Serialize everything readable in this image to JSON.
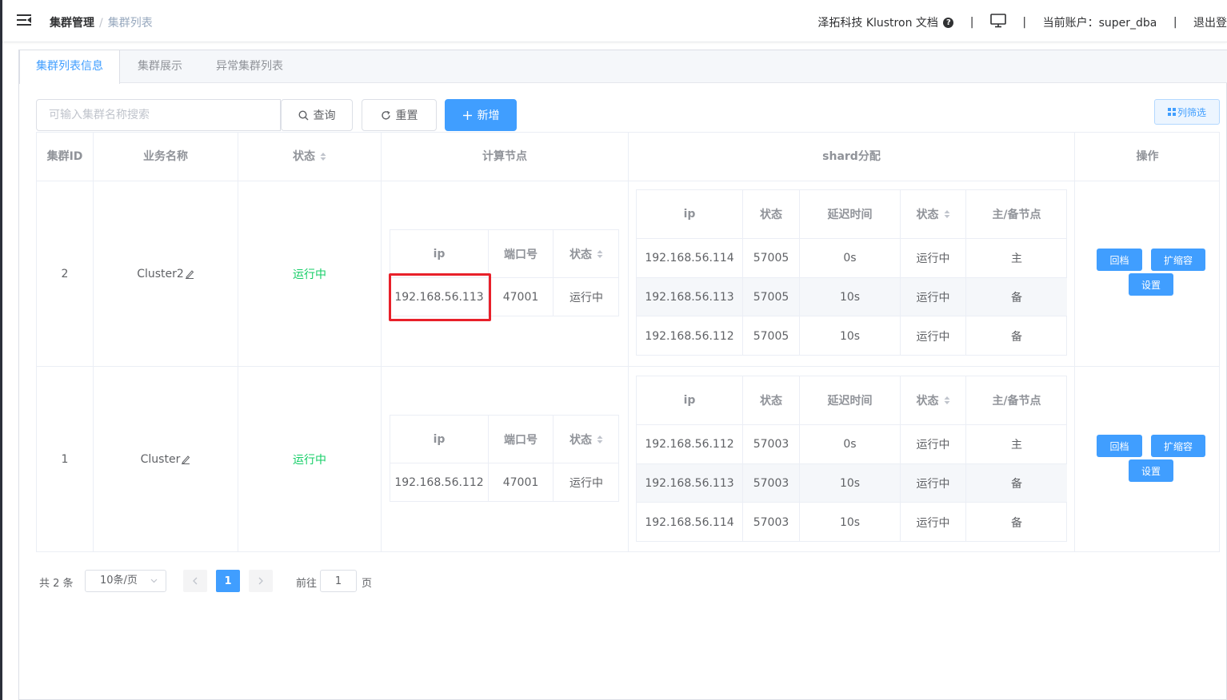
{
  "header": {
    "breadcrumb": [
      "集群管理",
      "集群列表"
    ],
    "brand_docs": "泽拓科技 Klustron 文档",
    "account_label": "当前账户：super_dba",
    "logout": "退出登"
  },
  "tabs": [
    "集群列表信息",
    "集群展示",
    "异常集群列表"
  ],
  "toolbar": {
    "search_placeholder": "可输入集群名称搜索",
    "query": "查询",
    "reset": "重置",
    "add": "新增",
    "column_filter": "列筛选"
  },
  "table": {
    "headers": {
      "id": "集群ID",
      "name": "业务名称",
      "status": "状态",
      "compute": "计算节点",
      "shard": "shard分配",
      "ops": "操作"
    },
    "compute_headers": [
      "ip",
      "端口号",
      "状态"
    ],
    "shard_headers": [
      "ip",
      "状态",
      "延迟时间",
      "状态",
      "主/备节点"
    ],
    "rows": [
      {
        "id": "2",
        "name": "Cluster2",
        "status": "运行中",
        "compute": [
          {
            "ip": "192.168.56.113",
            "port": "47001",
            "status": "运行中"
          }
        ],
        "shards": [
          {
            "ip": "192.168.56.114",
            "port": "57005",
            "delay": "0s",
            "status": "运行中",
            "role": "主"
          },
          {
            "ip": "192.168.56.113",
            "port": "57005",
            "delay": "10s",
            "status": "运行中",
            "role": "备"
          },
          {
            "ip": "192.168.56.112",
            "port": "57005",
            "delay": "10s",
            "status": "运行中",
            "role": "备"
          }
        ]
      },
      {
        "id": "1",
        "name": "Cluster",
        "status": "运行中",
        "compute": [
          {
            "ip": "192.168.56.112",
            "port": "47001",
            "status": "运行中"
          }
        ],
        "shards": [
          {
            "ip": "192.168.56.112",
            "port": "57003",
            "delay": "0s",
            "status": "运行中",
            "role": "主"
          },
          {
            "ip": "192.168.56.113",
            "port": "57003",
            "delay": "10s",
            "status": "运行中",
            "role": "备"
          },
          {
            "ip": "192.168.56.114",
            "port": "57003",
            "delay": "10s",
            "status": "运行中",
            "role": "备"
          }
        ]
      }
    ],
    "op_buttons": [
      "回档",
      "扩缩容",
      "设置"
    ]
  },
  "pagination": {
    "total": "共 2 条",
    "page_size": "10条/页",
    "current_page": "1",
    "goto_label": "前往",
    "goto_value": "1",
    "page_unit": "页"
  },
  "colors": {
    "primary": "#409eff",
    "running": "#13ce66",
    "highlight_border": "#e8202a"
  },
  "icons": [
    "menu-fold-icon",
    "help-circle-icon",
    "monitor-icon",
    "search-icon",
    "refresh-icon",
    "plus-icon",
    "grid-icon",
    "edit-icon",
    "sort-caret-icon",
    "chevron-left-icon",
    "chevron-right-icon",
    "chevron-down-icon"
  ]
}
